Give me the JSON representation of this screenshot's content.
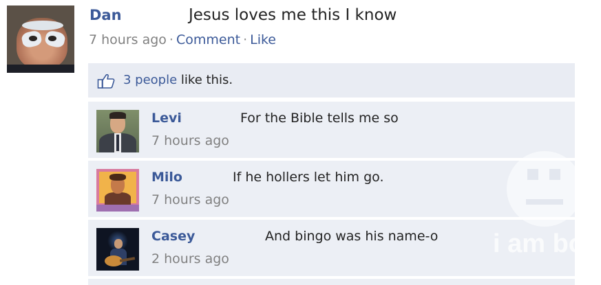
{
  "post": {
    "author": "Dan",
    "text": "Jesus loves me this I know",
    "time": "7 hours ago",
    "separator": "·",
    "comment_link": "Comment",
    "like_link": "Like"
  },
  "likes": {
    "count_link": "3 people",
    "suffix": "like this."
  },
  "comments": [
    {
      "name": "Levi",
      "text": "For the Bible tells me so",
      "time": "7 hours ago"
    },
    {
      "name": "Milo",
      "text": "If he hollers let him go.",
      "time": "7 hours ago"
    },
    {
      "name": "Casey",
      "text": "And bingo was his name-o",
      "time": "2 hours ago"
    }
  ],
  "watermark": {
    "text": "i am bored"
  },
  "colors": {
    "link": "#3b5998",
    "comment_bg": "#eceff5",
    "meta": "#808080"
  },
  "icons": [
    "thumbs-up-icon"
  ]
}
